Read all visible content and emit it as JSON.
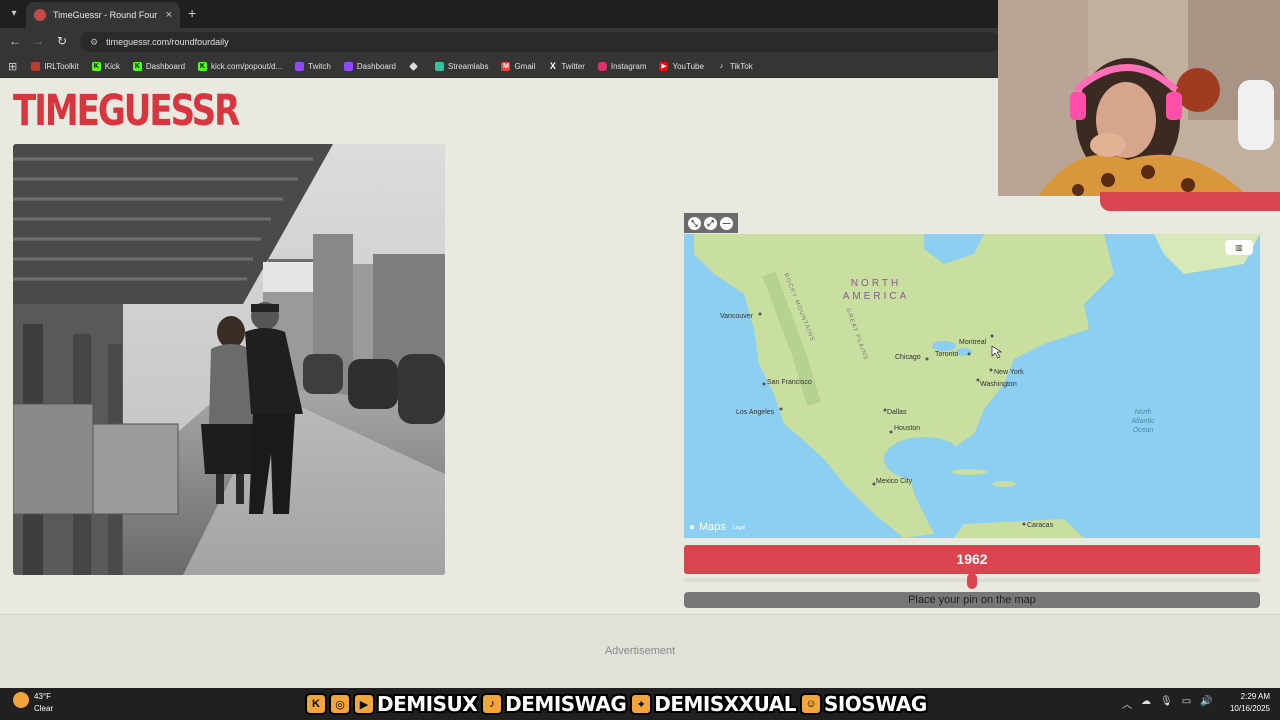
{
  "browser": {
    "tab_title": "TimeGuessr - Round Four",
    "tab_close": "×",
    "new_tab": "+",
    "url": "timeguessr.com/roundfourdaily",
    "bookmarks": [
      {
        "label": "IRLToolkit",
        "color": "#c0392b"
      },
      {
        "label": "Kick",
        "color": "#53fc18"
      },
      {
        "label": "Dashboard",
        "color": "#53fc18"
      },
      {
        "label": "kick.com/popout/d...",
        "color": "#53fc18"
      },
      {
        "label": "Twitch",
        "color": "#9146ff"
      },
      {
        "label": "Dashboard",
        "color": "#9146ff"
      },
      {
        "label": "Streamlabs",
        "color": "#31c3a2"
      },
      {
        "label": "Gmail",
        "color": "#ea4335"
      },
      {
        "label": "Twitter",
        "color": "#000000"
      },
      {
        "label": "Instagram",
        "color": "#e1306c"
      },
      {
        "label": "YouTube",
        "color": "#ff0000"
      },
      {
        "label": "TikTok",
        "color": "#111111"
      }
    ]
  },
  "page": {
    "logo": "TIMEGUESSR",
    "year": "1962",
    "slider_fraction": 0.5,
    "pin_prompt": "Place your pin on the map",
    "advertisement": "Advertisement"
  },
  "map": {
    "continent_line1": "NORTH",
    "continent_line2": "AMERICA",
    "ocean_line1": "North",
    "ocean_line2": "Atlantic",
    "ocean_line3": "Ocean",
    "rockies": "ROCKY MOUNTAINS",
    "plains": "GREAT PLAINS",
    "cities": [
      "Vancouver",
      "San Francisco",
      "Los Angeles",
      "Chicago",
      "Toronto",
      "Montreal",
      "New York",
      "Washington",
      "Dallas",
      "Houston",
      "Mexico City",
      "Caracas"
    ],
    "brand": "Maps",
    "legal": "Legal",
    "layer_button": "▥",
    "controls": [
      "⤡",
      "⤢",
      "—"
    ]
  },
  "taskbar": {
    "temp": "43°F",
    "condition": "Clear",
    "handles": [
      "DEMISUX",
      "DEMISWAG",
      "DEMISXXUAL",
      "SIOSWAG"
    ],
    "time": "2:29 AM",
    "date": "10/16/2025",
    "tray_icons": [
      "︿",
      "☁",
      "🎙",
      "▭",
      "🔊"
    ]
  },
  "colors": {
    "accent": "#d9454f",
    "background": "#eae9df",
    "ocean": "#8ccff0",
    "land": "#c8dfa0"
  }
}
